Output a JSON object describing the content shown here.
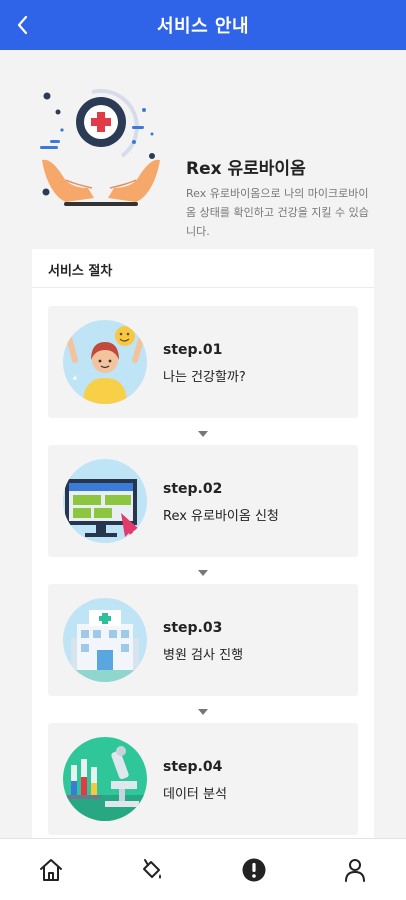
{
  "header": {
    "title": "서비스 안내"
  },
  "intro": {
    "title": "Rex 유로바이옴",
    "description": "Rex 유로바이옴으로 나의 마이크로바이옴 상태를 확인하고 건강을 지킬 수 있습니다."
  },
  "procedure": {
    "title": "서비스 절차",
    "steps": [
      {
        "label": "step.01",
        "desc": "나는 건강할까?"
      },
      {
        "label": "step.02",
        "desc": "Rex 유로바이옴 신청"
      },
      {
        "label": "step.03",
        "desc": "병원 검사 진행"
      },
      {
        "label": "step.04",
        "desc": "데이터 분석"
      }
    ]
  },
  "nav": [
    {
      "icon": "home-icon"
    },
    {
      "icon": "paint-bucket-icon"
    },
    {
      "icon": "exclamation-icon"
    },
    {
      "icon": "person-icon"
    }
  ],
  "colors": {
    "primary": "#2f63e8",
    "accent_red": "#e23b48",
    "accent_orange": "#f5a86a"
  }
}
